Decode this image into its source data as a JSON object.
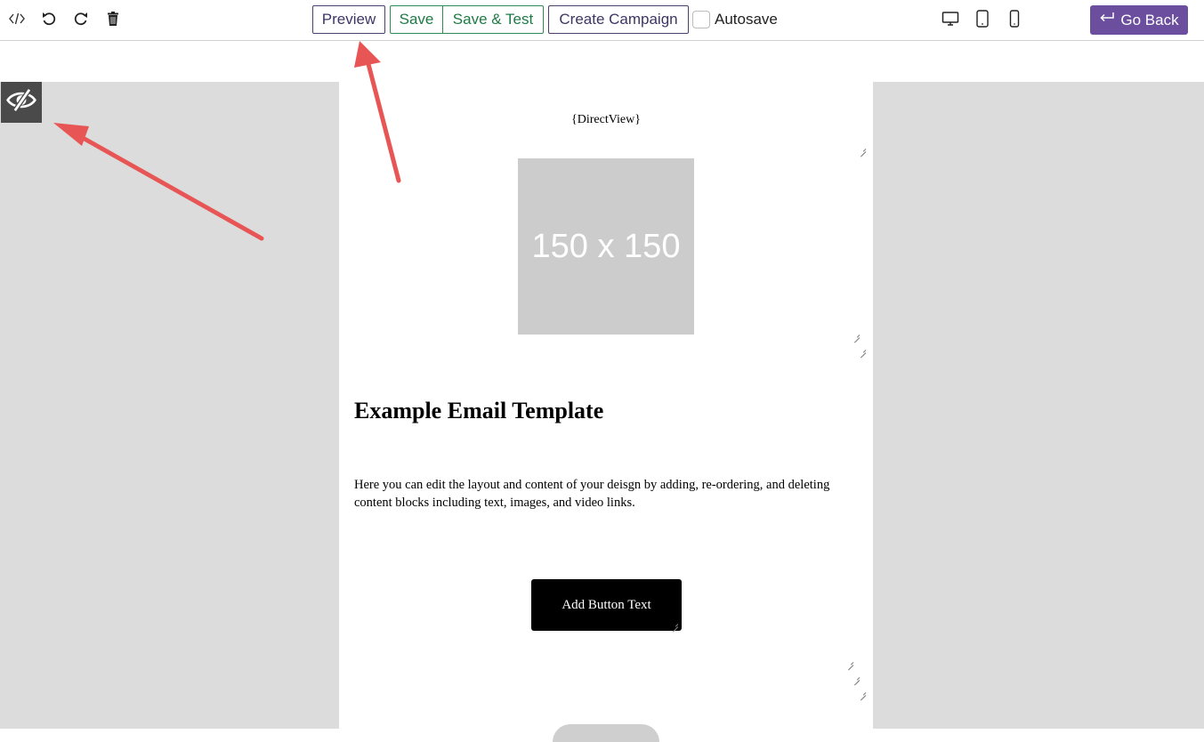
{
  "toolbar": {
    "icons": [
      "code-icon",
      "undo-icon",
      "redo-icon",
      "trash-icon"
    ],
    "preview_label": "Preview",
    "save_label": "Save",
    "save_test_label": "Save & Test",
    "create_campaign_label": "Create Campaign",
    "autosave_label": "Autosave",
    "devices": [
      "desktop-icon",
      "tablet-icon",
      "mobile-icon"
    ],
    "go_back_label": "Go Back"
  },
  "canvas": {
    "toggle_icon": "eye-slash-icon"
  },
  "email": {
    "directview": "{DirectView}",
    "image_placeholder": "150 x 150",
    "title": "Example Email Template",
    "body": "Here you can edit the layout and content of your deisgn by adding, re-ordering, and deleting content blocks including text, images, and video links.",
    "button_text": "Add Button Text"
  },
  "colors": {
    "accent": "#6b4f9e",
    "save_green": "#2e8b57",
    "annotation_arrow": "#e85555",
    "canvas_gray": "#dcdcdc"
  }
}
